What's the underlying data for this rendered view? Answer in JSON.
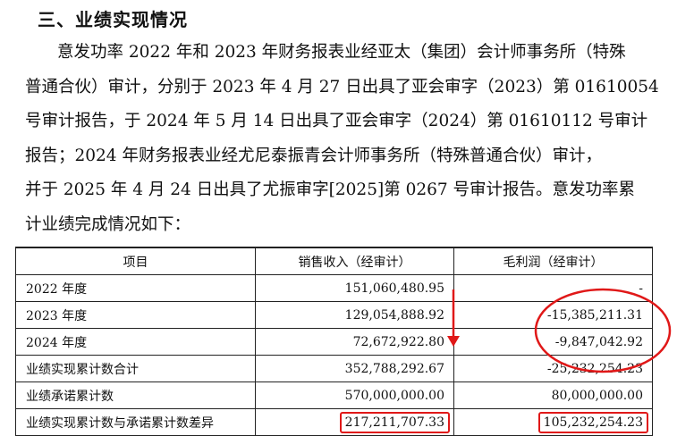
{
  "heading": "三、业绩实现情况",
  "paragraph_lines": [
    "意发功率 2022 年和 2023 年财务报表业经亚太（集团）会计师事务所（特殊",
    "普通合伙）审计，分别于 2023 年 4 月 27 日出具了亚会审字（2023）第  01610054",
    "号审计报告，于 2024 年 5 月 14 日出具了亚会审字（2024）第 01610112  号审计",
    "报告；2024  年财务报表业经尤尼泰振青会计师事务所（特殊普通合伙）审计，",
    "并于  2025 年 4 月 24 日出具了尤振审字[2025]第 0267 号审计报告。意发功率累",
    "计业绩完成情况如下："
  ],
  "table": {
    "headers": [
      "项目",
      "销售收入（经审计）",
      "毛利润（经审计）"
    ],
    "rows": [
      {
        "item": "2022 年度",
        "revenue": "151,060,480.95",
        "gross_profit": "-"
      },
      {
        "item": "2023 年度",
        "revenue": "129,054,888.92",
        "gross_profit": "-15,385,211.31"
      },
      {
        "item": "2024 年度",
        "revenue": "72,672,922.80",
        "gross_profit": "-9,847,042.92"
      },
      {
        "item": "业绩实现累计数合计",
        "revenue": "352,788,292.67",
        "gross_profit": "-25,232,254.23"
      },
      {
        "item": "业绩承诺累计数",
        "revenue": "570,000,000.00",
        "gross_profit": "80,000,000.00"
      },
      {
        "item": "业绩实现累计数与承诺累计数差异",
        "revenue": "217,211,707.33",
        "gross_profit": "105,232,254.23"
      }
    ]
  },
  "annotation_color": "#e01818"
}
